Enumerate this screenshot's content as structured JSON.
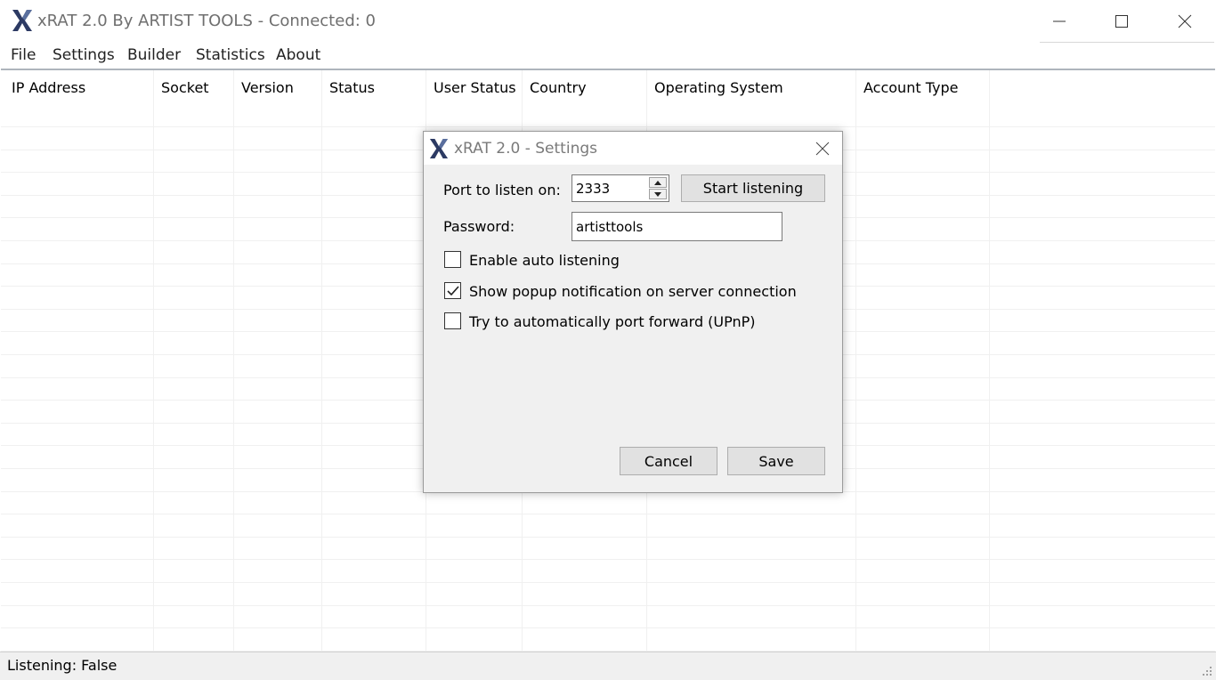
{
  "window": {
    "title": "xRAT 2.0 By ARTIST TOOLS - Connected: 0"
  },
  "menu": {
    "file": "File",
    "settings": "Settings",
    "builder": "Builder",
    "statistics": "Statistics",
    "about": "About"
  },
  "grid": {
    "columns": [
      "IP Address",
      "Socket",
      "Version",
      "Status",
      "User Status",
      "Country",
      "Operating System",
      "Account Type"
    ]
  },
  "statusbar": {
    "text": "Listening: False"
  },
  "dialog": {
    "title": "xRAT 2.0 - Settings",
    "port_label": "Port to listen on:",
    "port_value": "2333",
    "start_label": "Start listening",
    "password_label": "Password:",
    "password_value": "artisttools",
    "auto_listen": {
      "label": "Enable auto listening",
      "checked": false
    },
    "popup_notify": {
      "label": "Show popup notification on server connection",
      "checked": true
    },
    "upnp": {
      "label": "Try to automatically port forward (UPnP)",
      "checked": false
    },
    "cancel_label": "Cancel",
    "save_label": "Save"
  }
}
